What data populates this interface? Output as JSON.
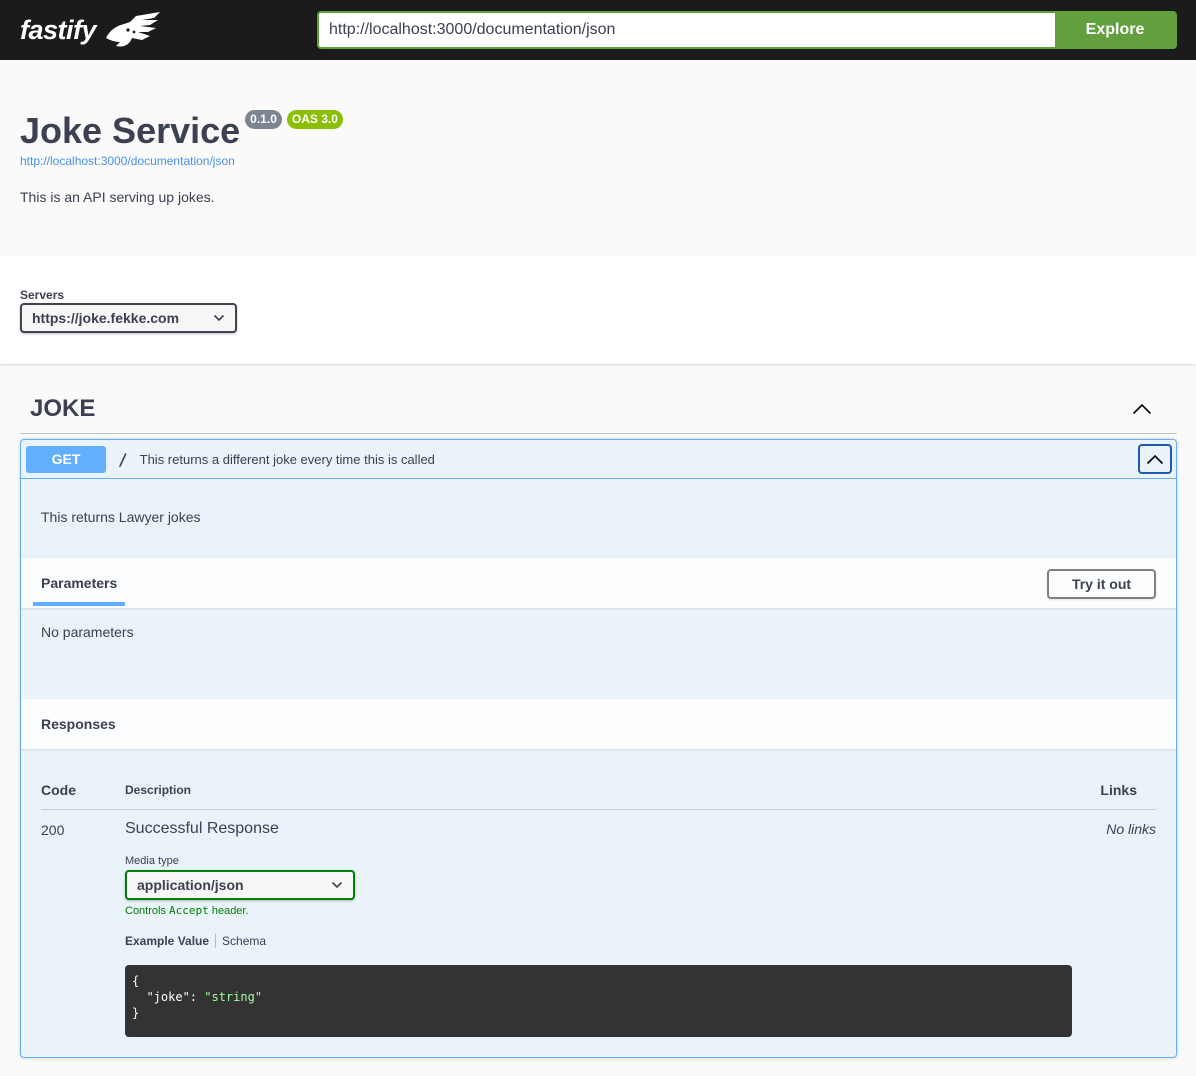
{
  "topbar": {
    "logo_text": "fastify",
    "logo_icon": "fastify-cheetah-icon",
    "url_value": "http://localhost:3000/documentation/json",
    "explore_label": "Explore",
    "accent_color": "#62a03f"
  },
  "info": {
    "title": "Joke Service",
    "version_badge": "0.1.0",
    "oas_badge": "OAS 3.0",
    "spec_url": "http://localhost:3000/documentation/json",
    "description": "This is an API serving up jokes."
  },
  "servers": {
    "label": "Servers",
    "selected": "https://joke.fekke.com"
  },
  "tag": {
    "name": "JOKE",
    "expanded": true
  },
  "operation": {
    "method": "GET",
    "path": "/",
    "summary": "This returns a different joke every time this is called",
    "description": "This returns Lawyer jokes",
    "method_color": "#61affe",
    "parameters": {
      "title": "Parameters",
      "try_label": "Try it out",
      "empty_text": "No parameters"
    },
    "responses": {
      "title": "Responses",
      "columns": {
        "code": "Code",
        "description": "Description",
        "links": "Links"
      },
      "rows": [
        {
          "code": "200",
          "description": "Successful Response",
          "links": "No links",
          "media_type_label": "Media type",
          "media_type": "application/json",
          "controls_note_prefix": "Controls ",
          "controls_note_code": "Accept",
          "controls_note_suffix": " header.",
          "tabs": {
            "example": "Example Value",
            "schema": "Schema"
          },
          "example": {
            "open": "{",
            "key": "  \"joke\": ",
            "value": "\"string\"",
            "close": "}"
          }
        }
      ]
    }
  }
}
